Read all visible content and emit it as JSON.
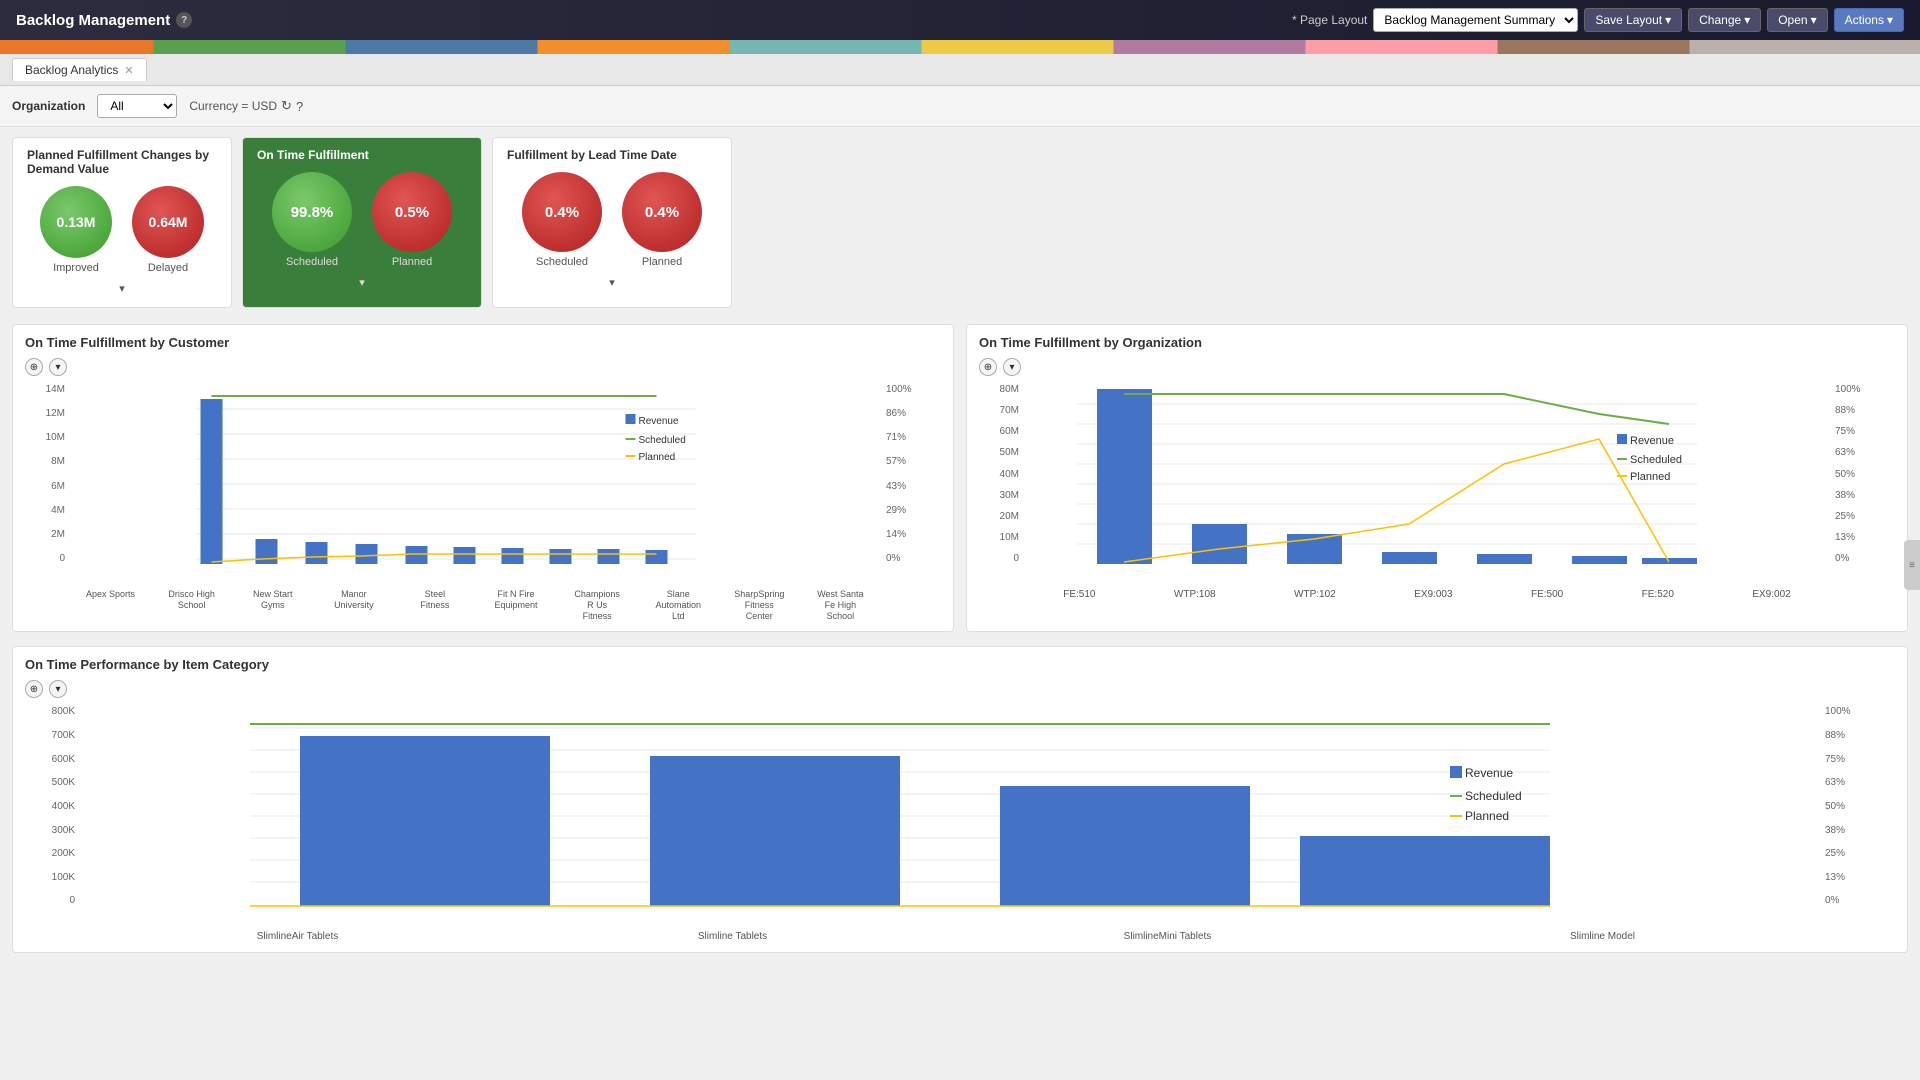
{
  "app": {
    "title": "Backlog Management",
    "help_icon": "?"
  },
  "header": {
    "page_layout_label": "* Page Layout",
    "page_layout_value": "Backlog Management Summary",
    "save_layout_label": "Save Layout",
    "change_label": "Change",
    "open_label": "Open",
    "actions_label": "Actions"
  },
  "tabs": [
    {
      "label": "Backlog Analytics",
      "active": true,
      "closable": true
    }
  ],
  "toolbar": {
    "org_label": "Organization",
    "org_value": "All",
    "currency_label": "Currency = USD"
  },
  "kpi_cards": [
    {
      "id": "planned-fulfillment",
      "title": "Planned Fulfillment Changes by Demand Value",
      "circles": [
        {
          "id": "improved",
          "value": "0.13M",
          "label": "Improved",
          "type": "green"
        },
        {
          "id": "delayed",
          "value": "0.64M",
          "label": "Delayed",
          "type": "red"
        }
      ],
      "highlighted": false
    },
    {
      "id": "on-time-fulfillment",
      "title": "On Time Fulfillment",
      "circles": [
        {
          "id": "scheduled",
          "value": "99.8%",
          "label": "Scheduled",
          "type": "green-large"
        },
        {
          "id": "planned",
          "value": "0.5%",
          "label": "Planned",
          "type": "red-large"
        }
      ],
      "highlighted": true
    },
    {
      "id": "fulfillment-lead-time",
      "title": "Fulfillment by Lead Time Date",
      "circles": [
        {
          "id": "scheduled",
          "value": "0.4%",
          "label": "Scheduled",
          "type": "red-large"
        },
        {
          "id": "planned",
          "value": "0.4%",
          "label": "Planned",
          "type": "red-large"
        }
      ],
      "highlighted": false
    }
  ],
  "charts": {
    "on_time_by_customer": {
      "title": "On Time Fulfillment by Customer",
      "y_labels_left": [
        "14M",
        "12M",
        "10M",
        "8M",
        "6M",
        "4M",
        "2M",
        "0"
      ],
      "y_labels_right": [
        "100%",
        "86%",
        "71%",
        "57%",
        "43%",
        "29%",
        "14%",
        "0%"
      ],
      "x_labels": [
        "Apex Sports",
        "Drisco High School",
        "New Start Gyms",
        "Manor University",
        "Steel Fitness",
        "Fit N Fire Equipment",
        "Champions R Us Fitness",
        "Slane Automation Ltd",
        "SharpSpring Fitness Center",
        "West Santa Fe High School"
      ],
      "legend": [
        {
          "label": "Revenue",
          "type": "bar",
          "color": "#4472c4"
        },
        {
          "label": "Scheduled",
          "type": "line",
          "color": "#70ad47"
        },
        {
          "label": "Planned",
          "type": "line",
          "color": "#ffc000"
        }
      ]
    },
    "on_time_by_org": {
      "title": "On Time Fulfillment by Organization",
      "y_labels_left": [
        "80M",
        "70M",
        "60M",
        "50M",
        "40M",
        "30M",
        "20M",
        "10M",
        "0"
      ],
      "y_labels_right": [
        "100%",
        "88%",
        "75%",
        "63%",
        "50%",
        "38%",
        "25%",
        "13%",
        "0%"
      ],
      "x_labels": [
        "FE:510",
        "WTP:108",
        "WTP:102",
        "EX9:003",
        "FE:500",
        "FE:520",
        "EX9:002"
      ],
      "legend": [
        {
          "label": "Revenue",
          "type": "bar",
          "color": "#4472c4"
        },
        {
          "label": "Scheduled",
          "type": "line",
          "color": "#70ad47"
        },
        {
          "label": "Planned",
          "type": "line",
          "color": "#ffc000"
        }
      ]
    },
    "on_time_by_category": {
      "title": "On Time Performance by Item Category",
      "y_labels_left": [
        "800K",
        "700K",
        "600K",
        "500K",
        "400K",
        "300K",
        "200K",
        "100K",
        "0"
      ],
      "y_labels_right": [
        "100%",
        "88%",
        "75%",
        "63%",
        "50%",
        "38%",
        "25%",
        "13%",
        "0%"
      ],
      "x_labels": [
        "SlimlineAir Tablets",
        "Slimline Tablets",
        "SlimlineMini Tablets",
        "Slimline Model"
      ],
      "legend": [
        {
          "label": "Revenue",
          "type": "bar",
          "color": "#4472c4"
        },
        {
          "label": "Scheduled",
          "type": "line",
          "color": "#70ad47"
        },
        {
          "label": "Planned",
          "type": "line",
          "color": "#ffc000"
        }
      ]
    }
  },
  "icons": {
    "help": "?",
    "caret_down": "▾",
    "refresh": "↻",
    "expand": "▾",
    "ctrl_plus": "⊕",
    "caret_small": "▾"
  }
}
